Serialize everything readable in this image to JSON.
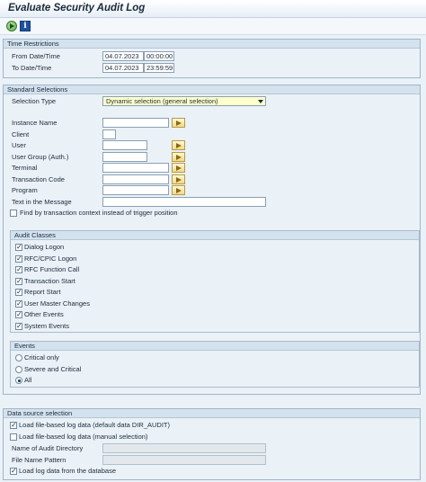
{
  "app": {
    "title": "Evaluate Security Audit Log"
  },
  "toolbar": {
    "execute_icon": "execute-icon",
    "info_icon": "info-icon",
    "info_glyph": "i"
  },
  "time_restrictions": {
    "title": "Time Restrictions",
    "from_label": "From Date/Time",
    "from_date": "04.07.2023",
    "from_time": "00:00:00",
    "to_label": "To Date/Time",
    "to_date": "04.07.2023",
    "to_time": "23:59:59"
  },
  "standard_selections": {
    "title": "Standard Selections",
    "selection_type_label": "Selection Type",
    "selection_type_value": "Dynamic selection (general selection)",
    "fields": [
      {
        "label": "Instance Name",
        "value": ""
      },
      {
        "label": "Client",
        "value": ""
      },
      {
        "label": "User",
        "value": ""
      },
      {
        "label": "User Group (Auth.)",
        "value": ""
      },
      {
        "label": "Terminal",
        "value": ""
      },
      {
        "label": "Transaction Code",
        "value": ""
      },
      {
        "label": "Program",
        "value": ""
      },
      {
        "label": "Text in the Message",
        "value": ""
      }
    ],
    "find_by_context_label": "Find by transaction context instead of trigger position",
    "find_by_context_checked": false,
    "audit_classes": {
      "title": "Audit Classes",
      "items": [
        {
          "label": "Dialog Logon",
          "checked": true
        },
        {
          "label": "RFC/CPIC Logon",
          "checked": true
        },
        {
          "label": "RFC Function Call",
          "checked": true
        },
        {
          "label": "Transaction Start",
          "checked": true
        },
        {
          "label": "Report Start",
          "checked": true
        },
        {
          "label": "User Master Changes",
          "checked": true
        },
        {
          "label": "Other Events",
          "checked": true
        },
        {
          "label": "System Events",
          "checked": true
        }
      ]
    },
    "events": {
      "title": "Events",
      "options": [
        {
          "label": "Critical only",
          "selected": false
        },
        {
          "label": "Severe and Critical",
          "selected": false
        },
        {
          "label": "All",
          "selected": true
        }
      ]
    }
  },
  "data_source": {
    "title": "Data source selection",
    "load_file_default_label": "Load file-based log data (default data DIR_AUDIT)",
    "load_file_default_checked": true,
    "load_file_manual_label": "Load file-based log data (manual selection)",
    "load_file_manual_checked": false,
    "audit_dir_label": "Name of Audit Directory",
    "audit_dir_value": "",
    "file_pattern_label": "File Name Pattern",
    "file_pattern_value": "",
    "load_db_label": "Load log data from the database",
    "load_db_checked": true
  },
  "glyphs": {
    "check": "✓"
  }
}
